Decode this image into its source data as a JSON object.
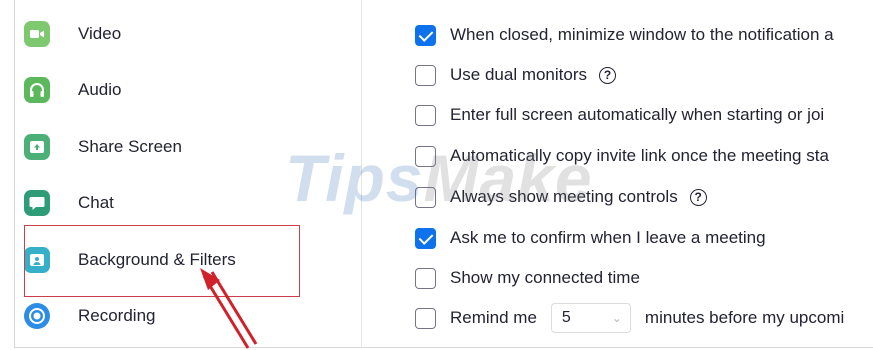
{
  "sidebar": {
    "items": [
      {
        "label": "Video",
        "icon": "video-icon",
        "color": "#7ec86f"
      },
      {
        "label": "Audio",
        "icon": "headphones-icon",
        "color": "#5cb85c"
      },
      {
        "label": "Share Screen",
        "icon": "share-screen-icon",
        "color": "#4caf78"
      },
      {
        "label": "Chat",
        "icon": "chat-icon",
        "color": "#2e9d77"
      },
      {
        "label": "Background & Filters",
        "icon": "background-icon",
        "color": "#36b0c9"
      },
      {
        "label": "Recording",
        "icon": "record-icon",
        "color": "#2d8ce6"
      }
    ],
    "highlighted": "Background & Filters"
  },
  "settings": {
    "rows": [
      {
        "label": "When closed, minimize window to the notification a",
        "checked": true
      },
      {
        "label": "Use dual monitors",
        "checked": false,
        "help": true
      },
      {
        "label": "Enter full screen automatically when starting or joi",
        "checked": false
      },
      {
        "label": "Automatically copy invite link once the meeting sta",
        "checked": false
      },
      {
        "label": "Always show meeting controls",
        "checked": false,
        "help": true
      },
      {
        "label": "Ask me to confirm when I leave a meeting",
        "checked": true
      },
      {
        "label": "Show my connected time",
        "checked": false
      },
      {
        "label": "Remind me",
        "checked": false,
        "select_value": "5",
        "suffix": "minutes before my upcomi"
      }
    ],
    "help_glyph": "?"
  },
  "watermark": {
    "part1": "Tips",
    "part2": "Make"
  },
  "colors": {
    "accent": "#0e72ed",
    "highlight_border": "#c9404a",
    "arrow": "#d0202a"
  }
}
